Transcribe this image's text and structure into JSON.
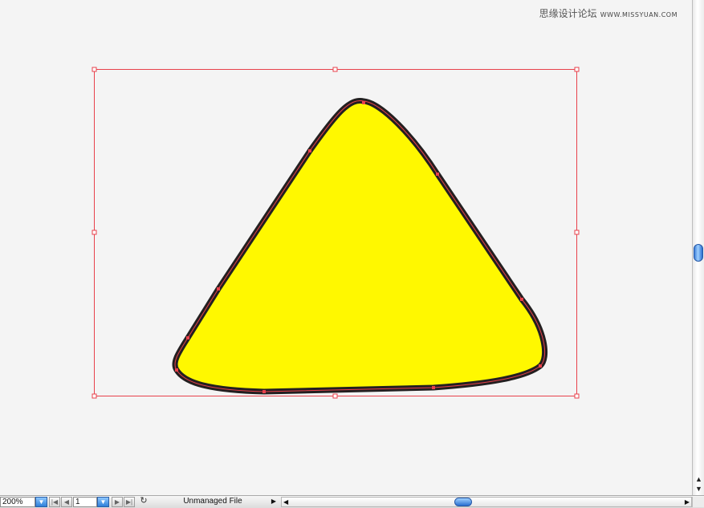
{
  "watermark": {
    "cn": "思缘设计论坛",
    "url": "WWW.MISSYUAN.COM"
  },
  "artwork": {
    "shape": "rounded-triangle",
    "fill_color": "#fff800",
    "stroke_color": "#231f20",
    "selection_color": "#e8414b"
  },
  "statusbar": {
    "zoom": "200%",
    "page": "1",
    "file_status": "Unmanaged File"
  },
  "icons": {
    "zoom_dropdown": "chevron-down-icon",
    "first_page": "first-page-icon",
    "prev_page": "prev-page-icon",
    "page_dropdown": "chevron-down-icon",
    "next_page": "next-page-icon",
    "last_page": "last-page-icon",
    "status_menu": "triangle-right-icon"
  }
}
